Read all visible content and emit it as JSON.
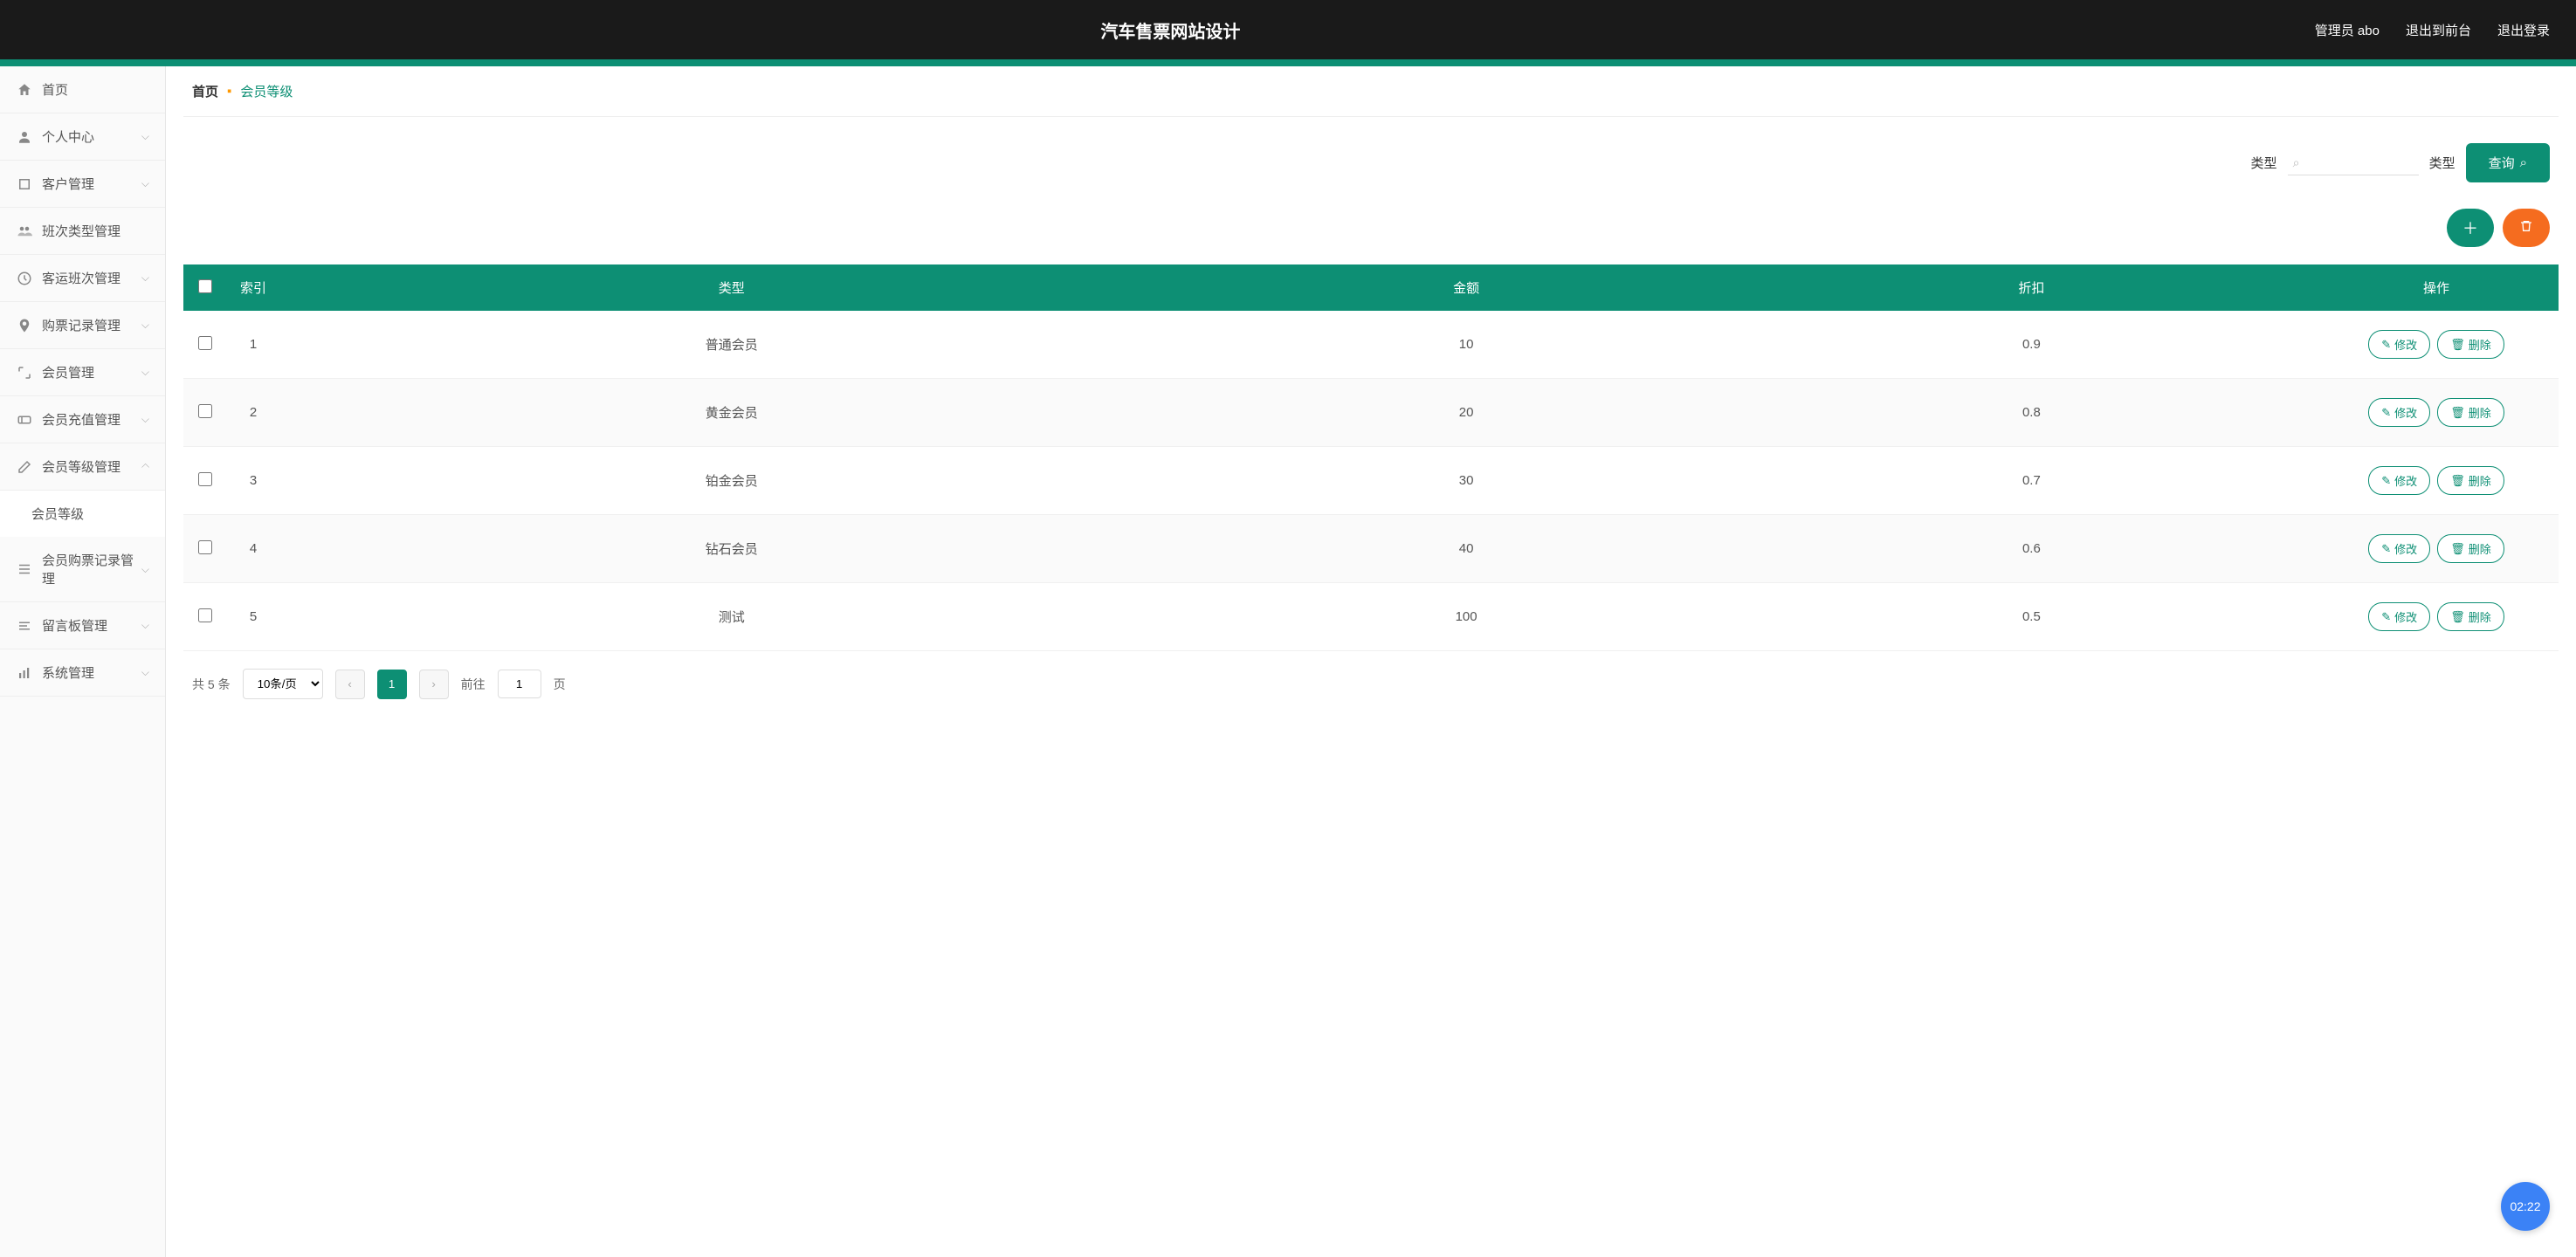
{
  "header": {
    "title": "汽车售票网站设计",
    "user_label": "管理员 abo",
    "to_front": "退出到前台",
    "logout": "退出登录"
  },
  "sidebar": {
    "items": [
      {
        "icon": "home",
        "label": "首页",
        "arrow": ""
      },
      {
        "icon": "user",
        "label": "个人中心",
        "arrow": "down"
      },
      {
        "icon": "crop",
        "label": "客户管理",
        "arrow": "down"
      },
      {
        "icon": "group",
        "label": "班次类型管理",
        "arrow": ""
      },
      {
        "icon": "clock",
        "label": "客运班次管理",
        "arrow": "down"
      },
      {
        "icon": "pin",
        "label": "购票记录管理",
        "arrow": "down"
      },
      {
        "icon": "expand",
        "label": "会员管理",
        "arrow": "down"
      },
      {
        "icon": "ticket",
        "label": "会员充值管理",
        "arrow": "down"
      },
      {
        "icon": "edit",
        "label": "会员等级管理",
        "arrow": "up"
      },
      {
        "icon": "",
        "label": "会员等级",
        "arrow": "",
        "sub": true
      },
      {
        "icon": "list",
        "label": "会员购票记录管理",
        "arrow": "down"
      },
      {
        "icon": "lines",
        "label": "留言板管理",
        "arrow": "down"
      },
      {
        "icon": "bars",
        "label": "系统管理",
        "arrow": "down"
      }
    ]
  },
  "breadcrumb": {
    "home": "首页",
    "current": "会员等级"
  },
  "filter": {
    "label1": "类型",
    "label2": "类型",
    "query": "查询"
  },
  "table": {
    "headers": [
      "",
      "索引",
      "类型",
      "金额",
      "折扣",
      "操作"
    ],
    "rows": [
      {
        "index": "1",
        "type": "普通会员",
        "amount": "10",
        "discount": "0.9"
      },
      {
        "index": "2",
        "type": "黄金会员",
        "amount": "20",
        "discount": "0.8"
      },
      {
        "index": "3",
        "type": "铂金会员",
        "amount": "30",
        "discount": "0.7"
      },
      {
        "index": "4",
        "type": "钻石会员",
        "amount": "40",
        "discount": "0.6"
      },
      {
        "index": "5",
        "type": "测试",
        "amount": "100",
        "discount": "0.5"
      }
    ],
    "edit_label": "修改",
    "delete_label": "删除"
  },
  "pagination": {
    "total": "共 5 条",
    "per_page": "10条/页",
    "goto_prefix": "前往",
    "goto_suffix": "页",
    "current": "1",
    "input": "1"
  },
  "badge": "02:22"
}
